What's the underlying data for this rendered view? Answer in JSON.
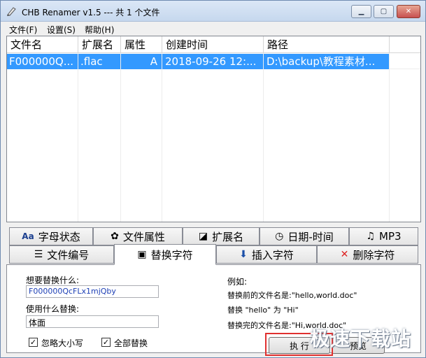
{
  "window": {
    "title": "CHB Renamer v1.5 --- 共 1 个文件"
  },
  "menu": [
    "文件(F)",
    "设置(S)",
    "帮助(H)"
  ],
  "list": {
    "columns": [
      "文件名",
      "扩展名",
      "属性",
      "创建时间",
      "路径"
    ],
    "rows": [
      {
        "name": "F000000Q...",
        "ext": ".flac",
        "attr": "A",
        "created": "2018-09-26 12:...",
        "path": "D:\\backup\\教程素材..."
      }
    ]
  },
  "tabs_row1": [
    {
      "icon": "Aa",
      "label": "字母状态"
    },
    {
      "icon": "✿",
      "label": "文件属性"
    },
    {
      "icon": "◪",
      "label": "扩展名"
    },
    {
      "icon": "◷",
      "label": "日期-时间"
    },
    {
      "icon": "♫",
      "label": "MP3"
    }
  ],
  "tabs_row2": [
    {
      "icon": "☰",
      "label": "文件编号"
    },
    {
      "icon": "▣",
      "label": "替换字符"
    },
    {
      "icon": "⬇",
      "label": "插入字符"
    },
    {
      "icon": "✕",
      "label": "删除字符"
    }
  ],
  "active_tab": "替换字符",
  "replace": {
    "find_label": "想要替换什么:",
    "find_value": "F000000QcFLx1mjQby",
    "with_label": "使用什么替换:",
    "with_value": "体面",
    "ignore_case_label": "忽略大小写",
    "ignore_case_checked": true,
    "replace_all_label": "全部替换",
    "replace_all_checked": true
  },
  "example": {
    "title": "例如:",
    "before": "替换前的文件名是:\"hello,world.doc\"",
    "rule": "替换 \"hello\" 为 \"Hi\"",
    "after": "替换完的文件名是:\"Hi,world.doc\""
  },
  "buttons": {
    "execute": "执 行",
    "preview": "预览"
  },
  "watermark": "极速下载站",
  "colors": {
    "selection": "#3399ff",
    "highlight": "#e0302f"
  }
}
